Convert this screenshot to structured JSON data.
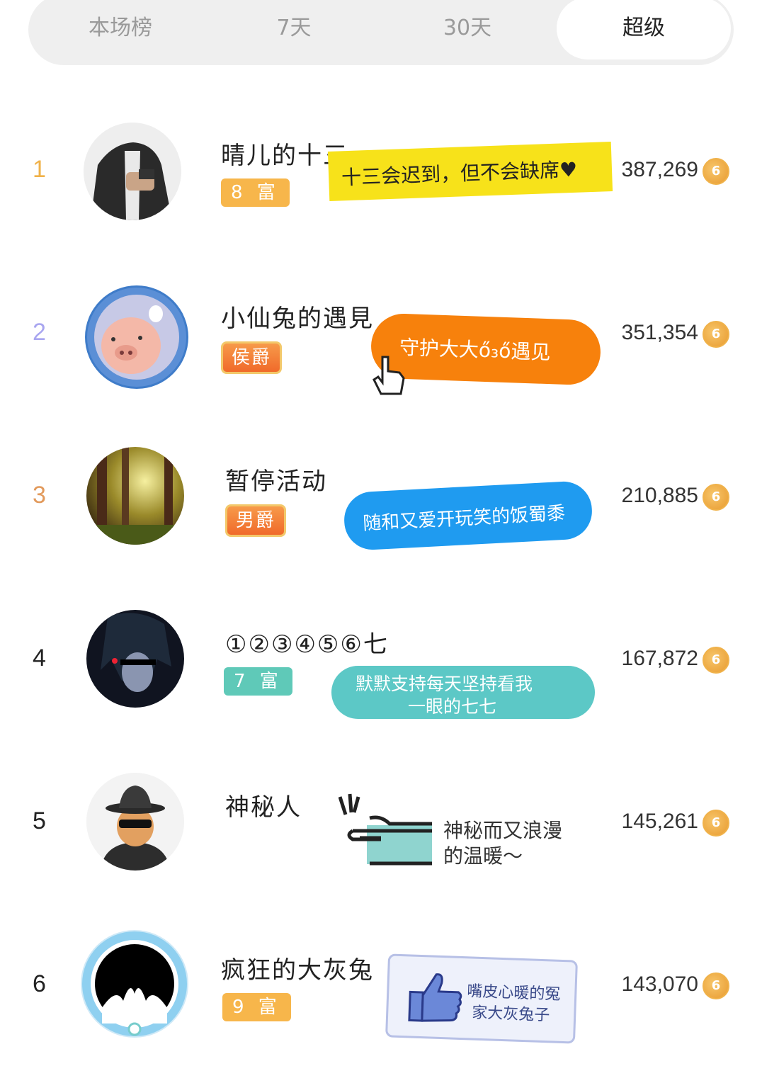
{
  "tabs": [
    {
      "label": "本场榜"
    },
    {
      "label": "7天"
    },
    {
      "label": "30天"
    },
    {
      "label": "超级"
    }
  ],
  "active_tab": 3,
  "coin_glyph": "6",
  "ranking": [
    {
      "rank": "1",
      "name": "晴儿的十三",
      "badge": "8 富",
      "score": "387,269",
      "tag": "十三会迟到，但不会缺席♥"
    },
    {
      "rank": "2",
      "name": "小仙兔的遇見",
      "badge": "侯爵",
      "score": "351,354",
      "tag": "守护大大ő₃ő遇见"
    },
    {
      "rank": "3",
      "name": "暂停活动",
      "badge": "男爵",
      "score": "210,885",
      "tag": "随和又爱开玩笑的饭蜀黍"
    },
    {
      "rank": "4",
      "name": "①②③④⑤⑥七",
      "badge": "7 富",
      "score": "167,872",
      "tag_line1": "默默支持每天坚持看我",
      "tag_line2": "一眼的七七"
    },
    {
      "rank": "5",
      "name": "神秘人",
      "score": "145,261",
      "tag_line1": "神秘而又浪漫",
      "tag_line2": "的温暖～"
    },
    {
      "rank": "6",
      "name": "疯狂的大灰兔",
      "badge": "9 富",
      "score": "143,070",
      "tag_line1": "嘴皮心暖的冤",
      "tag_line2": "家大灰兔子"
    }
  ],
  "colors": {
    "rank1": "#f0b24a",
    "rank2": "#a9a6f0",
    "rank3": "#e29a5c",
    "accent_coin": "#eea83a"
  }
}
